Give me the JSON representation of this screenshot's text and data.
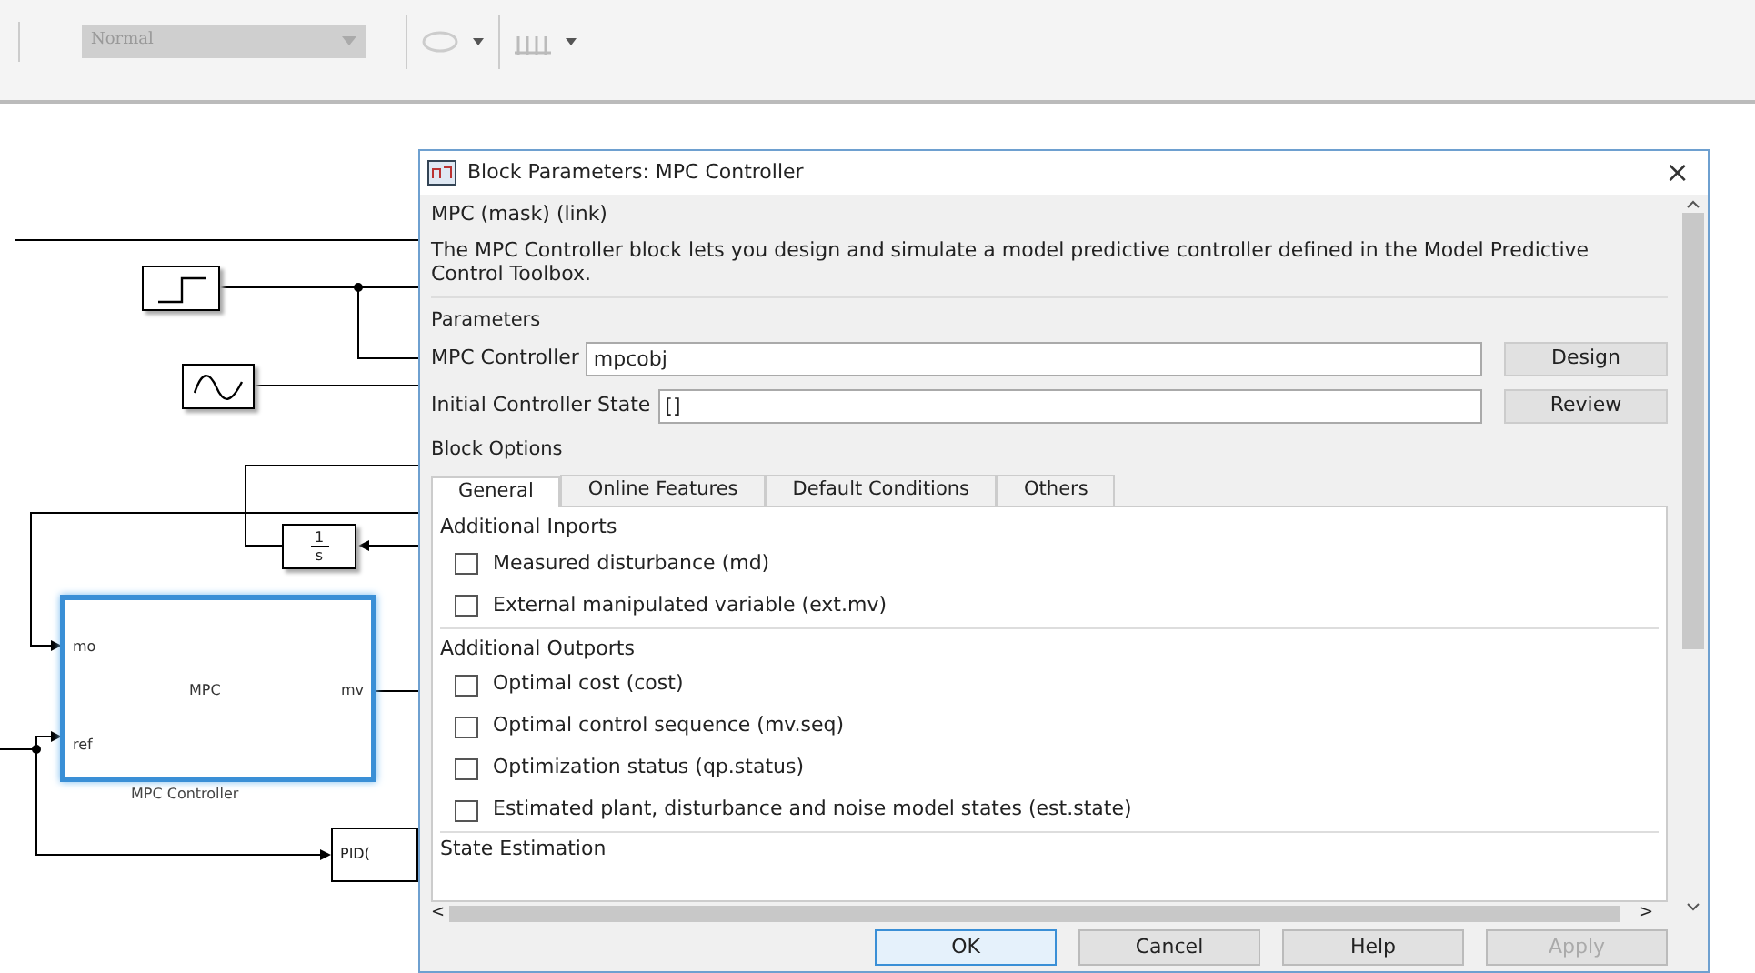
{
  "toolbar": {
    "simulation_mode": "Normal",
    "simulation_mode_disabled": true
  },
  "diagram": {
    "blocks": [
      {
        "kind": "step"
      },
      {
        "kind": "sine"
      },
      {
        "kind": "integrator",
        "numerator": "1",
        "denominator": "s"
      },
      {
        "kind": "mpc",
        "center": "MPC",
        "inputs": [
          "mo",
          "ref"
        ],
        "outputs": [
          "mv"
        ],
        "name": "MPC Controller",
        "selected": true
      },
      {
        "kind": "pid",
        "center": "PID("
      }
    ]
  },
  "dialog": {
    "title": "Block Parameters: MPC Controller",
    "close": "×",
    "mask": "MPC (mask) (link)",
    "description": "The MPC Controller block lets you design and simulate a model predictive controller defined in the Model Predictive Control Toolbox.",
    "parameters_heading": "Parameters",
    "fields": [
      {
        "label": "MPC Controller",
        "value": "mpcobj",
        "button": "Design"
      },
      {
        "label": "Initial Controller State",
        "value": "[]",
        "button": "Review"
      }
    ],
    "block_options_heading": "Block Options",
    "tabs": [
      {
        "label": "General",
        "selected": true
      },
      {
        "label": "Online Features",
        "selected": false
      },
      {
        "label": "Default Conditions",
        "selected": false
      },
      {
        "label": "Others",
        "selected": false
      }
    ],
    "groups": [
      {
        "title": "Additional Inports",
        "options": [
          {
            "label": "Measured disturbance (md)",
            "checked": false
          },
          {
            "label": "External manipulated variable (ext.mv)",
            "checked": false
          }
        ]
      },
      {
        "title": "Additional Outports",
        "options": [
          {
            "label": "Optimal cost (cost)",
            "checked": false
          },
          {
            "label": "Optimal control sequence (mv.seq)",
            "checked": false
          },
          {
            "label": "Optimization status (qp.status)",
            "checked": false
          },
          {
            "label": "Estimated plant, disturbance and noise model states (est.state)",
            "checked": false
          }
        ]
      }
    ],
    "next_group": "State Estimation",
    "scroll_left": "<",
    "scroll_right": ">",
    "buttons": [
      {
        "label": "OK",
        "default": true,
        "disabled": false
      },
      {
        "label": "Cancel",
        "default": false,
        "disabled": false
      },
      {
        "label": "Help",
        "default": false,
        "disabled": false
      },
      {
        "label": "Apply",
        "default": false,
        "disabled": true
      }
    ]
  }
}
